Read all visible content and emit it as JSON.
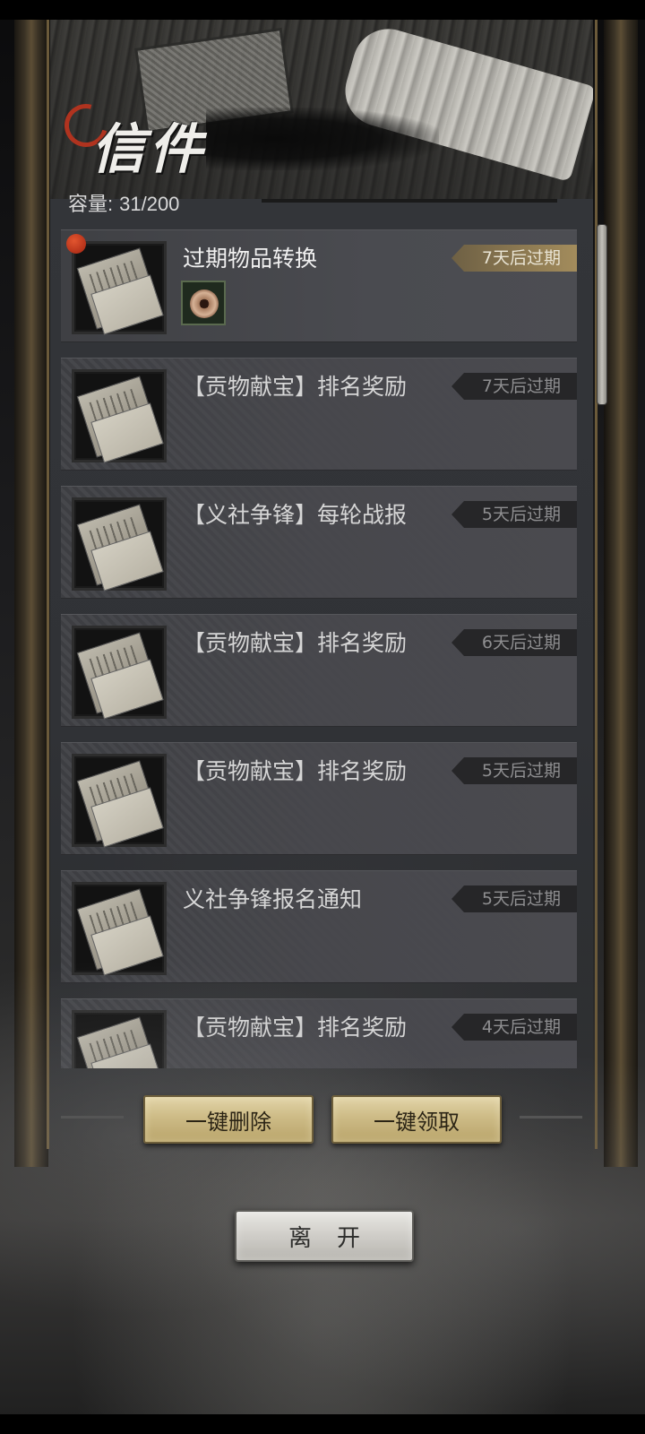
{
  "header": {
    "title": "信件",
    "capacity_label": "容量:",
    "capacity_value": "31/200"
  },
  "mails": [
    {
      "title": "过期物品转换",
      "expiry": "7天后过期",
      "unread": true,
      "expiry_style": "gold",
      "attachment_icon": "coin-icon"
    },
    {
      "title": "【贡物献宝】排名奖励",
      "expiry": "7天后过期",
      "unread": false,
      "expiry_style": "dark"
    },
    {
      "title": "【义社争锋】每轮战报",
      "expiry": "5天后过期",
      "unread": false,
      "expiry_style": "dark"
    },
    {
      "title": "【贡物献宝】排名奖励",
      "expiry": "6天后过期",
      "unread": false,
      "expiry_style": "dark"
    },
    {
      "title": "【贡物献宝】排名奖励",
      "expiry": "5天后过期",
      "unread": false,
      "expiry_style": "dark"
    },
    {
      "title": "义社争锋报名通知",
      "expiry": "5天后过期",
      "unread": false,
      "expiry_style": "dark"
    },
    {
      "title": "【贡物献宝】排名奖励",
      "expiry": "4天后过期",
      "unread": false,
      "expiry_style": "dark"
    }
  ],
  "actions": {
    "delete_all": "一键删除",
    "claim_all": "一键领取",
    "leave": "离开"
  },
  "colors": {
    "unread_dot": "#c63a1f",
    "gold_button": "#cdbb86",
    "expiry_gold": "#a38c5c"
  }
}
